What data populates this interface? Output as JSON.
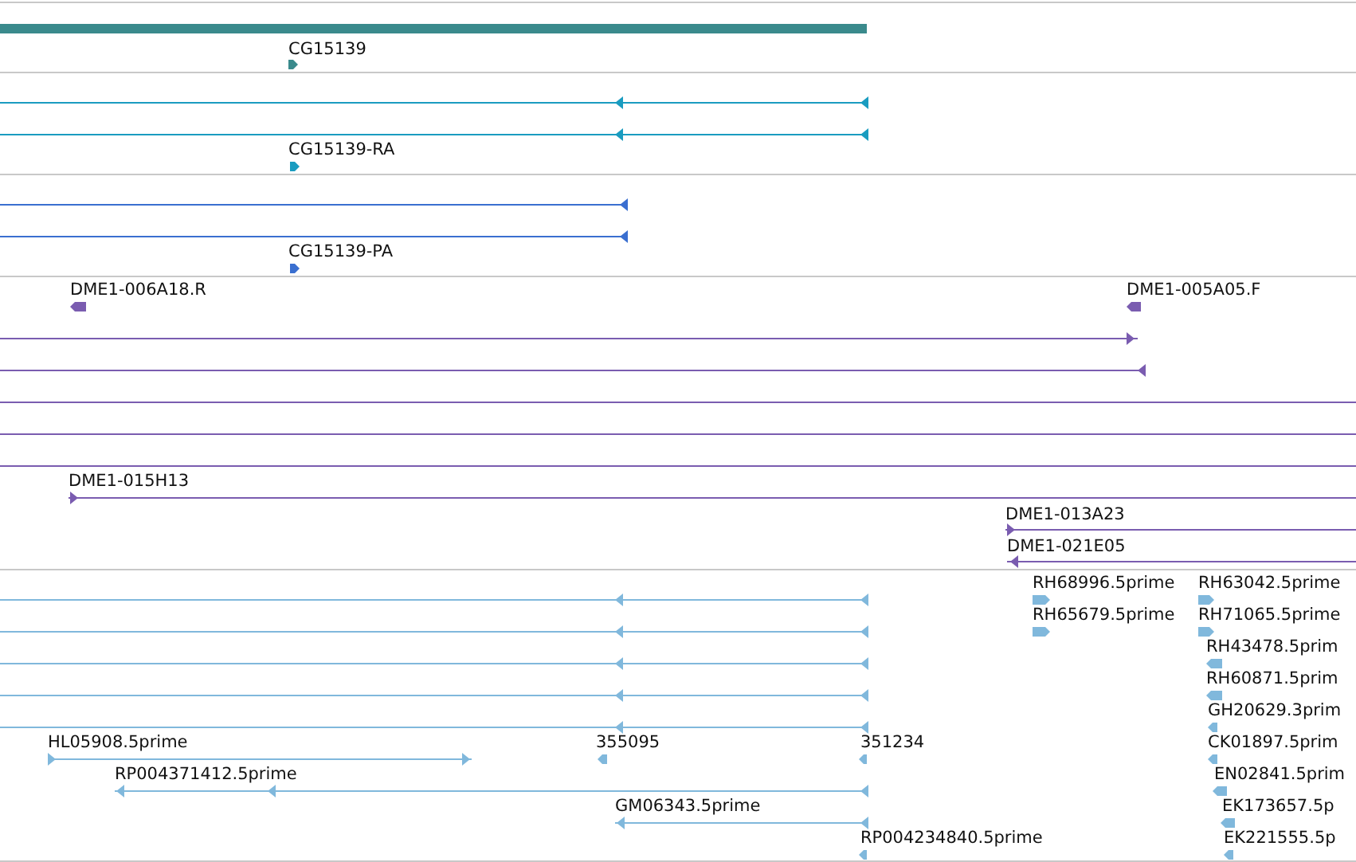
{
  "tracks": [
    {
      "color": "#3a8a8c",
      "features": [
        {
          "kind": "bar"
        },
        {
          "kind": "marker",
          "label": "CG15139",
          "reverse": false
        }
      ]
    },
    {
      "color": "#1a9cc0",
      "features": [
        {
          "kind": "line",
          "reverse": true
        },
        {
          "kind": "line",
          "reverse": true
        },
        {
          "kind": "marker",
          "label": "CG15139-RA",
          "reverse": false
        }
      ]
    },
    {
      "color": "#3a6fd0",
      "features": [
        {
          "kind": "line",
          "reverse": true
        },
        {
          "kind": "line",
          "reverse": true
        },
        {
          "kind": "marker",
          "label": "CG15139-PA",
          "reverse": false
        }
      ]
    },
    {
      "color": "#7a5cb0",
      "features": [
        {
          "kind": "marker",
          "label": "DME1-006A18.R",
          "reverse": true
        },
        {
          "kind": "marker",
          "label": "DME1-005A05.F",
          "reverse": true
        },
        {
          "kind": "line",
          "reverse": false
        },
        {
          "kind": "line",
          "reverse": true
        },
        {
          "kind": "line"
        },
        {
          "kind": "line"
        },
        {
          "kind": "line"
        },
        {
          "kind": "line",
          "label": "DME1-015H13",
          "reverse": false
        },
        {
          "kind": "line",
          "label": "DME1-013A23",
          "reverse": false
        },
        {
          "kind": "line",
          "label": "DME1-021E05",
          "reverse": true
        }
      ]
    },
    {
      "color": "#80b8dc",
      "features": [
        {
          "kind": "marker",
          "label": "RH68996.5prime",
          "reverse": false
        },
        {
          "kind": "marker",
          "label": "RH63042.5prime",
          "reverse": false
        },
        {
          "kind": "line",
          "reverse": true
        },
        {
          "kind": "marker",
          "label": "RH65679.5prime",
          "reverse": false
        },
        {
          "kind": "marker",
          "label": "RH71065.5prime",
          "reverse": false
        },
        {
          "kind": "line",
          "reverse": true
        },
        {
          "kind": "marker",
          "label": "RH43478.5prim",
          "reverse": true
        },
        {
          "kind": "line",
          "reverse": true
        },
        {
          "kind": "marker",
          "label": "RH60871.5prim",
          "reverse": true
        },
        {
          "kind": "line",
          "reverse": true
        },
        {
          "kind": "marker",
          "label": "GH20629.3prim",
          "reverse": true
        },
        {
          "kind": "line",
          "reverse": true
        },
        {
          "kind": "line",
          "label": "HL05908.5prime",
          "reverse": false
        },
        {
          "kind": "marker",
          "label": "355095",
          "reverse": true
        },
        {
          "kind": "marker",
          "label": "351234",
          "reverse": true
        },
        {
          "kind": "marker",
          "label": "CK01897.5prim",
          "reverse": true
        },
        {
          "kind": "line",
          "label": "RP004371412.5prime",
          "reverse": true
        },
        {
          "kind": "marker",
          "label": "EN02841.5prim",
          "reverse": true
        },
        {
          "kind": "line",
          "label": "GM06343.5prime",
          "reverse": true
        },
        {
          "kind": "marker",
          "label": "EK173657.5p",
          "reverse": true
        },
        {
          "kind": "marker",
          "label": "RP004234840.5prime",
          "reverse": true
        },
        {
          "kind": "marker",
          "label": "EK221555.5p",
          "reverse": true
        }
      ]
    }
  ]
}
